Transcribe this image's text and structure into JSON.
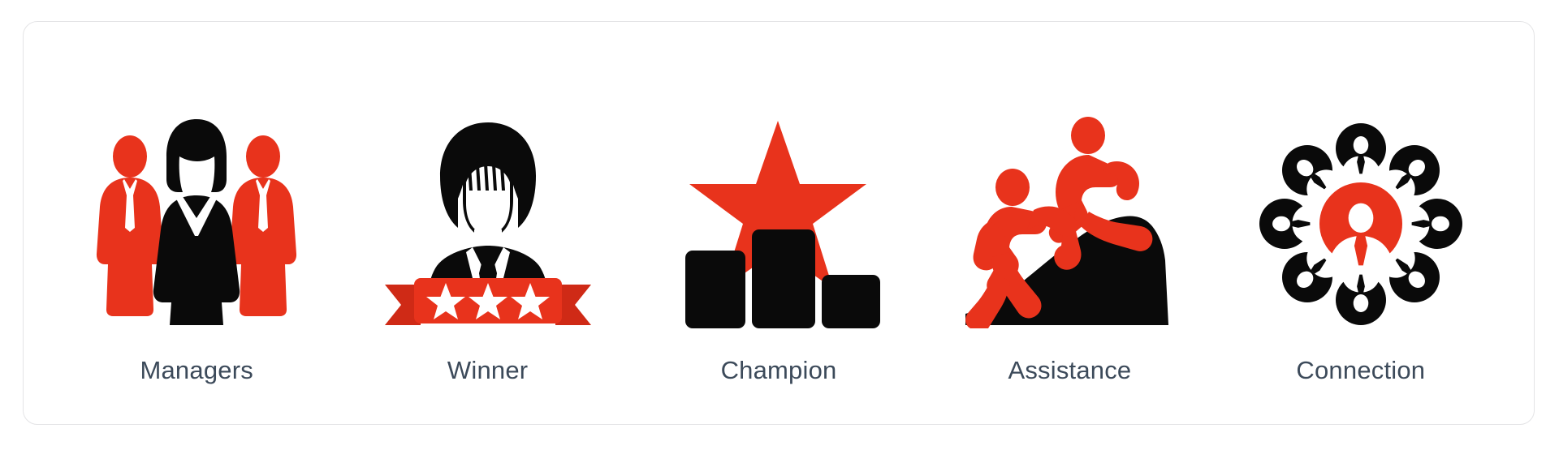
{
  "page": {
    "background_color": "#ffffff",
    "card_border_color": "#e4e4e6",
    "accent_red": "#e8331c",
    "accent_black": "#0a0a0a",
    "label_color": "#3c4a5a"
  },
  "icons": [
    {
      "id": "managers",
      "label": "Managers",
      "icon_name": "managers-group-icon",
      "description": "Three business people standing, center figure black woman, two red men in ties",
      "colors": [
        "#e8331c",
        "#0a0a0a"
      ]
    },
    {
      "id": "winner",
      "label": "Winner",
      "icon_name": "winner-ribbon-icon",
      "description": "Businesswoman bust above a red award ribbon banner with three white stars",
      "stars": 3,
      "colors": [
        "#0a0a0a",
        "#e8331c"
      ]
    },
    {
      "id": "champion",
      "label": "Champion",
      "icon_name": "champion-podium-star-icon",
      "description": "Three black bar chart podium columns with a red star above the tallest middle bar",
      "colors": [
        "#0a0a0a",
        "#e8331c"
      ]
    },
    {
      "id": "assistance",
      "label": "Assistance",
      "icon_name": "assistance-helping-hand-icon",
      "description": "Red figure on a black hill cliff pulling up another red figure by the hand",
      "colors": [
        "#e8331c",
        "#0a0a0a"
      ]
    },
    {
      "id": "connection",
      "label": "Connection",
      "icon_name": "connection-network-icon",
      "description": "Red circular avatar at center surrounded by eight black circular person avatars",
      "satellite_count": 8,
      "colors": [
        "#e8331c",
        "#0a0a0a"
      ]
    }
  ]
}
